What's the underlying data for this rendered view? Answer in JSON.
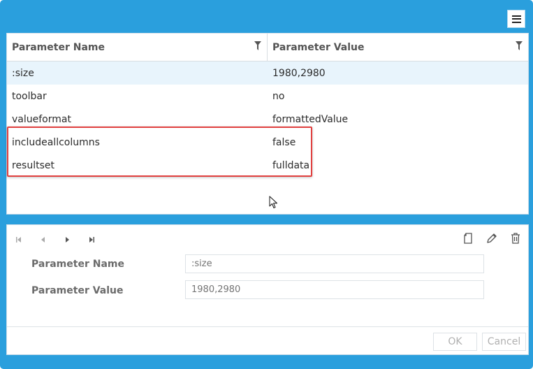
{
  "grid": {
    "columns": [
      {
        "label": "Parameter Name"
      },
      {
        "label": "Parameter Value"
      }
    ],
    "rows": [
      {
        "name": ":size",
        "value": "1980,2980",
        "selected": true
      },
      {
        "name": "toolbar",
        "value": "no"
      },
      {
        "name": "valueformat",
        "value": "formattedValue"
      },
      {
        "name": "includeallcolumns",
        "value": "false",
        "highlighted": true
      },
      {
        "name": "resultset",
        "value": "fulldata",
        "highlighted": true
      }
    ]
  },
  "editor": {
    "name_label": "Parameter Name",
    "value_label": "Parameter Value",
    "name_placeholder": ":size",
    "value_placeholder": "1980,2980"
  },
  "footer": {
    "ok_label": "OK",
    "cancel_label": "Cancel"
  },
  "colors": {
    "frame": "#2a9fdd",
    "selected_row": "#e8f4fc",
    "highlight_border": "#e1403f"
  },
  "icons": {
    "menu": "hamburger-icon",
    "filter": "filter-icon",
    "nav": [
      "first-page-icon",
      "prev-page-icon",
      "next-page-icon",
      "last-page-icon"
    ],
    "actions": [
      "new-document-icon",
      "edit-pencil-icon",
      "trash-icon"
    ]
  }
}
